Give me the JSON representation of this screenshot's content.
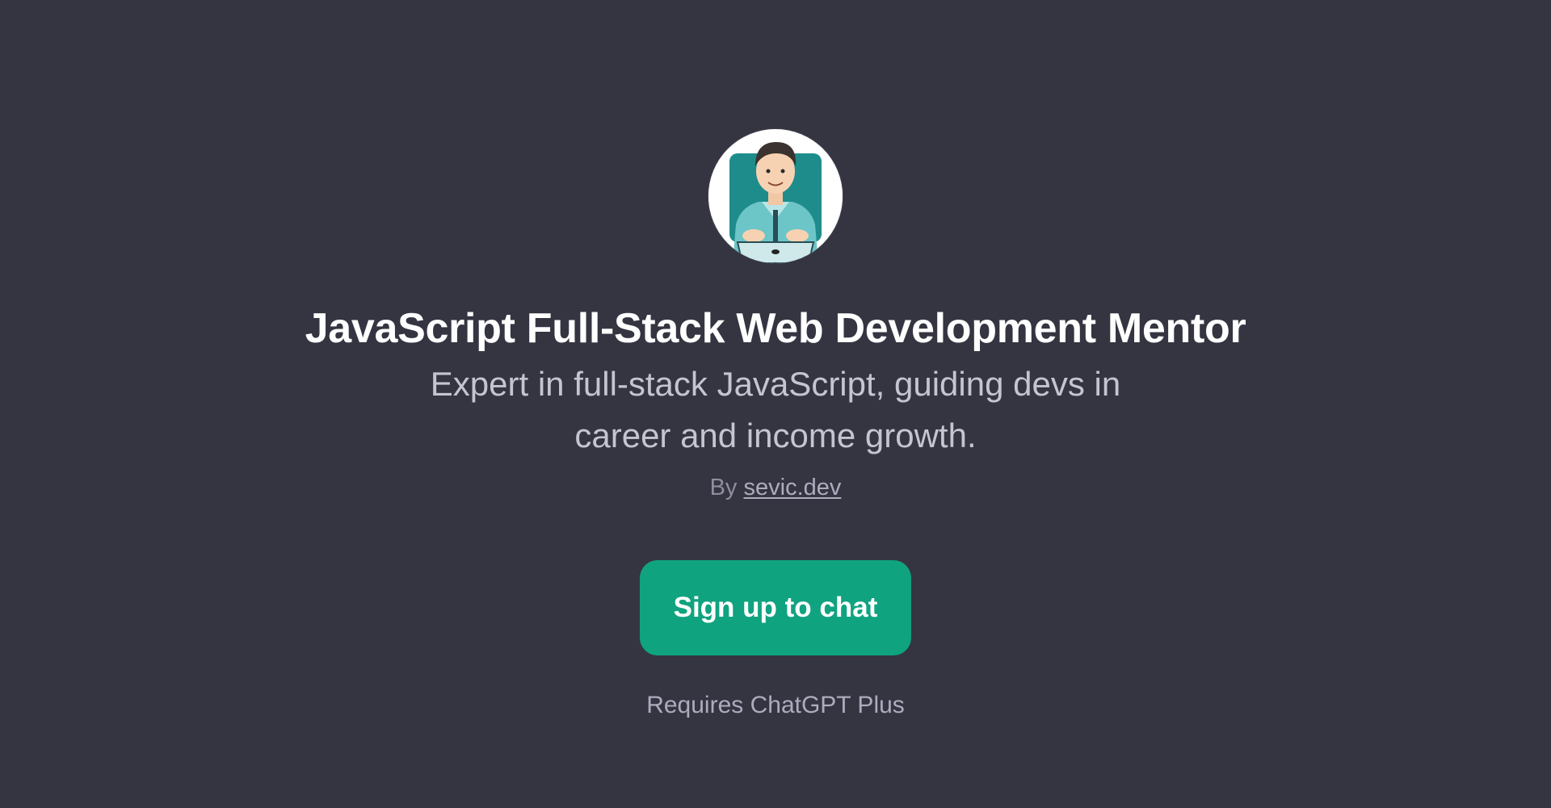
{
  "gpt": {
    "avatar_icon": "developer-at-laptop-illustration",
    "title": "JavaScript Full-Stack Web Development Mentor",
    "description": "Expert in full-stack JavaScript, guiding devs in career and income growth.",
    "byline_prefix": "By",
    "author": "sevic.dev"
  },
  "actions": {
    "signup_label": "Sign up to chat",
    "requirement": "Requires ChatGPT Plus"
  },
  "colors": {
    "background": "#343541",
    "accent": "#10a37f",
    "title": "#ffffff",
    "muted": "#8e8ea0"
  }
}
